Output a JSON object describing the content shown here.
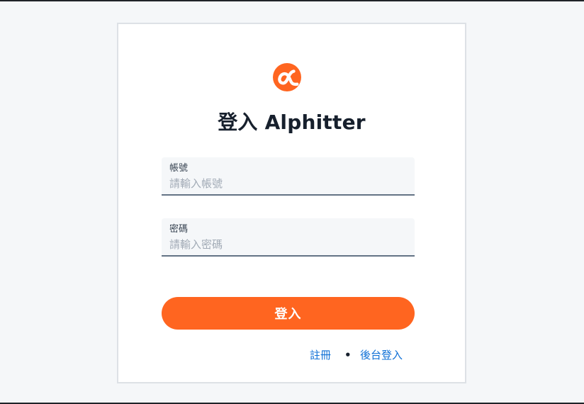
{
  "colors": {
    "page_background": "#f5f7f9",
    "card_background": "#ffffff",
    "brand_orange": "#ff6520",
    "link_blue": "#0f70d6",
    "input_underline": "#637385"
  },
  "logo": {
    "icon": "alpha-logo-icon"
  },
  "header": {
    "title": "登入 Alphitter"
  },
  "form": {
    "username": {
      "label": "帳號",
      "placeholder": "請輸入帳號",
      "value": ""
    },
    "password": {
      "label": "密碼",
      "placeholder": "請輸入密碼",
      "value": ""
    },
    "submit_label": "登入"
  },
  "footer": {
    "register_label": "註冊",
    "separator": "•",
    "admin_login_label": "後台登入"
  }
}
